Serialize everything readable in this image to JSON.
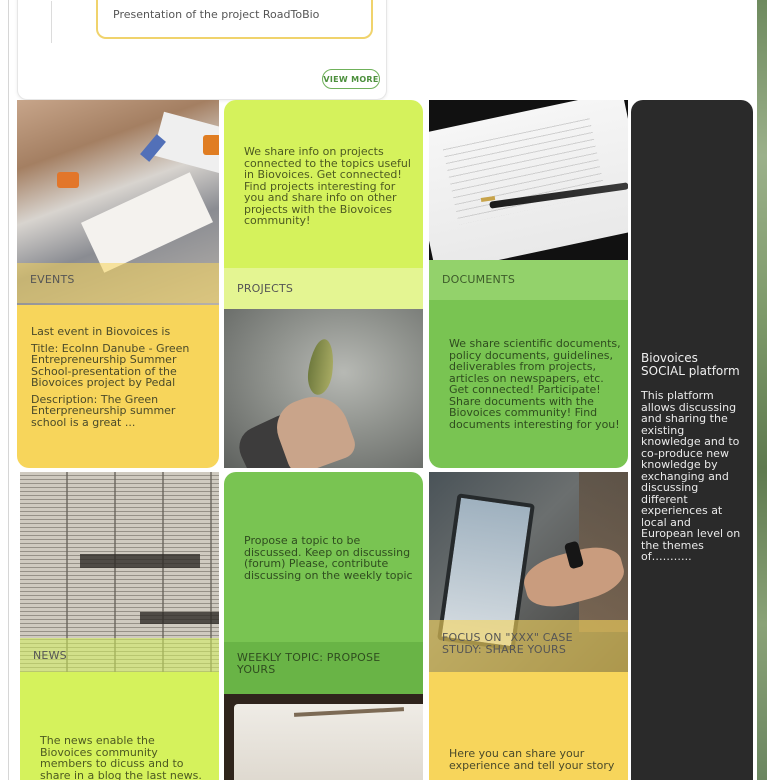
{
  "top_card": {
    "item_text": "Presentation of the project RoadToBio",
    "view_more_label": "VIEW MORE"
  },
  "tiles": {
    "events": {
      "title": "EVENTS",
      "paragraphs": [
        "Last event in Biovoices is",
        "Title: EcoInn Danube - Green Entrepreneurship Summer School-presentation of the Biovoices project by Pedal",
        "Description:  The  Green Enterpreneurship summer school is a great ..."
      ]
    },
    "projects": {
      "title": "PROJECTS",
      "text": "We share info on projects connected to the topics useful in Biovoices. Get connected! Find projects interesting for you and share info on other projects with the Biovoices community!"
    },
    "documents": {
      "title": "DOCUMENTS",
      "text": "We share scientific documents, policy documents, guidelines, deliverables from projects, articles on newspapers, etc. Get connected! Participate! Share documents with the Biovoices community! Find documents interesting for you!"
    },
    "social": {
      "title": "Biovoices SOCIAL platform",
      "text": "This platform allows discussing and sharing the existing knowledge and to co-produce new knowledge by exchanging and discussing different experiences at local and European level on the themes of……….."
    },
    "news": {
      "title": "NEWS",
      "text": "The news enable the Biovoices community members to dicuss and to share in a blog the last news."
    },
    "weekly_topic": {
      "title": "WEEKLY TOPIC: PROPOSE YOURS",
      "text": "Propose a topic to be discussed. Keep on discussing (forum) Please, contribute discussing on the weekly topic"
    },
    "case_study": {
      "title": "FOCUS ON \"XXX\" CASE STUDY: SHARE YOURS",
      "text": "Here you can share your experience and tell your story"
    }
  },
  "colors": {
    "lime": "#d5f25c",
    "green": "#79c452",
    "yellow": "#f7d55b",
    "dark": "#2a2a2a",
    "button_green": "#6fb15a"
  }
}
